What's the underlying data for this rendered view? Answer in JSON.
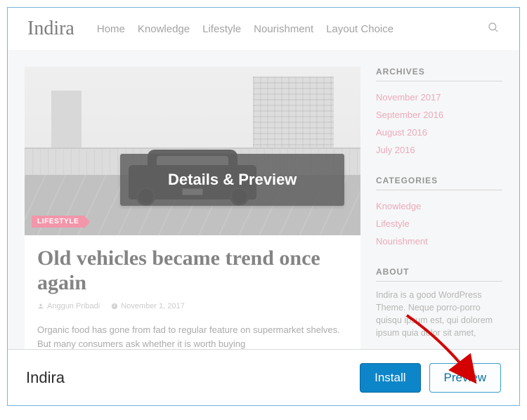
{
  "preview": {
    "site_title": "Indira",
    "nav": [
      "Home",
      "Knowledge",
      "Lifestyle",
      "Nourishment",
      "Layout Choice"
    ],
    "post": {
      "tag": "LIFESTYLE",
      "title": "Old vehicles became trend once again",
      "author": "Anggun Pribadi",
      "date": "November 1, 2017",
      "excerpt": "Organic food has gone from fad to regular feature on supermarket shelves. But many consumers ask whether it is worth buying"
    },
    "widgets": {
      "archives": {
        "title": "ARCHIVES",
        "items": [
          "November 2017",
          "September 2016",
          "August 2016",
          "July 2016"
        ]
      },
      "categories": {
        "title": "CATEGORIES",
        "items": [
          "Knowledge",
          "Lifestyle",
          "Nourishment"
        ]
      },
      "about": {
        "title": "ABOUT",
        "text": "Indira is a good WordPress Theme. Neque porro-porro quisqu ipsum est, qui dolorem ipsum quia dolor sit amet,"
      }
    },
    "hover_label": "Details & Preview"
  },
  "footer": {
    "theme_name": "Indira",
    "install_label": "Install",
    "preview_label": "Preview"
  }
}
